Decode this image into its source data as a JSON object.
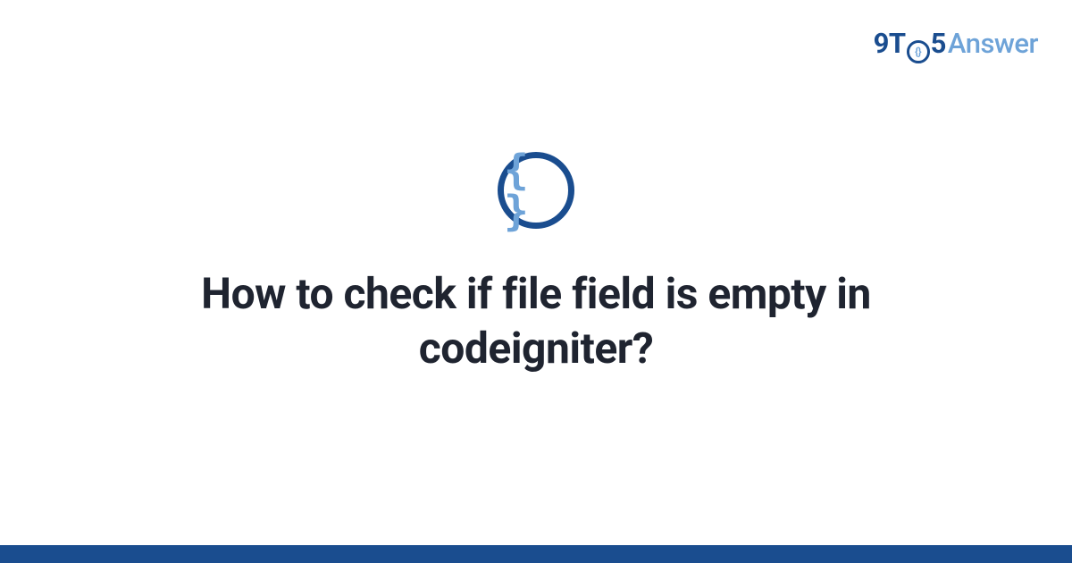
{
  "brand": {
    "part1": "9T",
    "clock_inner": "{}",
    "part2": "5",
    "part3": "Answer"
  },
  "topic_icon": {
    "glyph": "{ }",
    "semantic": "code-braces"
  },
  "headline": "How to check if file field is empty in codeigniter?",
  "accent_color": "#1a4d8f"
}
